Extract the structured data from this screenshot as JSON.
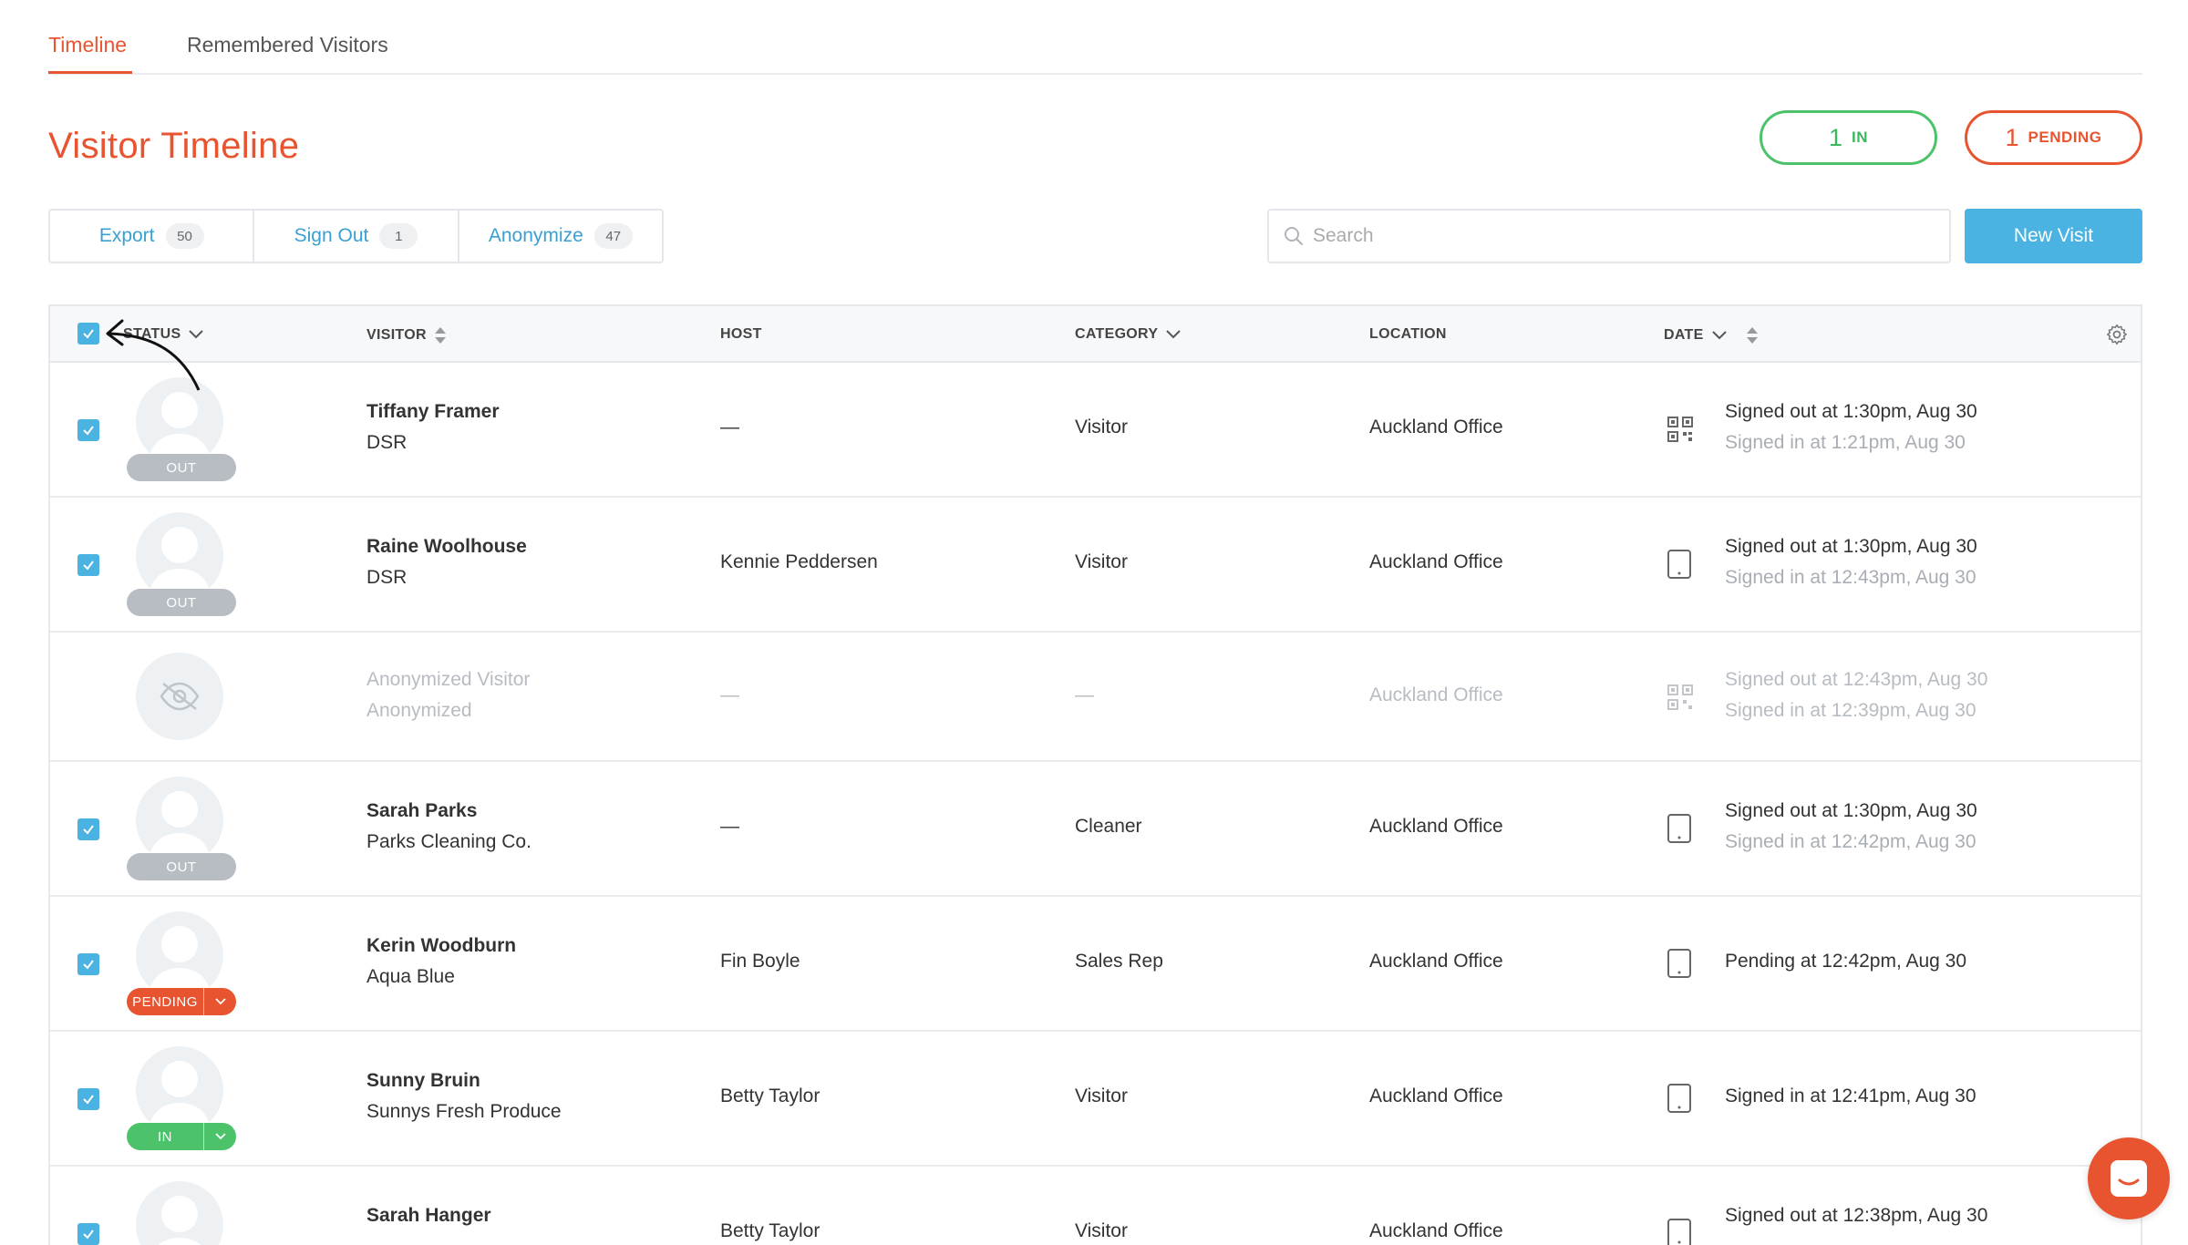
{
  "tabs": [
    {
      "label": "Timeline",
      "active": true
    },
    {
      "label": "Remembered Visitors",
      "active": false
    }
  ],
  "page_title": "Visitor Timeline",
  "summary": {
    "in": {
      "count": "1",
      "label": "IN"
    },
    "pending": {
      "count": "1",
      "label": "PENDING"
    }
  },
  "actions": {
    "export": {
      "label": "Export",
      "count": "50"
    },
    "sign_out": {
      "label": "Sign Out",
      "count": "1"
    },
    "anonymize": {
      "label": "Anonymize",
      "count": "47"
    }
  },
  "search": {
    "placeholder": "Search"
  },
  "new_visit_label": "New Visit",
  "columns": {
    "status": "STATUS",
    "visitor": "VISITOR",
    "host": "HOST",
    "category": "CATEGORY",
    "location": "LOCATION",
    "date": "DATE"
  },
  "rows": [
    {
      "checked": true,
      "badge": "OUT",
      "name": "Tiffany Framer",
      "company": "DSR",
      "host": "—",
      "category": "Visitor",
      "location": "Auckland Office",
      "device": "qr-code",
      "date_main": "Signed out at 1:30pm, Aug 30",
      "date_sub": "Signed in at 1:21pm, Aug 30"
    },
    {
      "checked": true,
      "badge": "OUT",
      "name": "Raine Woolhouse",
      "company": "DSR",
      "host": "Kennie Peddersen",
      "category": "Visitor",
      "location": "Auckland Office",
      "device": "tablet",
      "date_main": "Signed out at 1:30pm, Aug 30",
      "date_sub": "Signed in at 12:43pm, Aug 30"
    },
    {
      "checked": false,
      "badge": "",
      "anonymized": true,
      "name": "Anonymized Visitor",
      "company": "Anonymized",
      "host": "—",
      "category": "—",
      "location": "Auckland Office",
      "device": "qr-code",
      "date_main": "Signed out at 12:43pm, Aug 30",
      "date_sub": "Signed in at 12:39pm, Aug 30"
    },
    {
      "checked": true,
      "badge": "OUT",
      "name": "Sarah Parks",
      "company": "Parks Cleaning Co.",
      "host": "—",
      "category": "Cleaner",
      "location": "Auckland Office",
      "device": "tablet",
      "date_main": "Signed out at 1:30pm, Aug 30",
      "date_sub": "Signed in at 12:42pm, Aug 30"
    },
    {
      "checked": true,
      "badge": "PENDING",
      "name": "Kerin Woodburn",
      "company": "Aqua Blue",
      "host": "Fin Boyle",
      "category": "Sales Rep",
      "location": "Auckland Office",
      "device": "tablet",
      "date_main": "Pending at 12:42pm, Aug 30",
      "date_sub": ""
    },
    {
      "checked": true,
      "badge": "IN",
      "name": "Sunny Bruin",
      "company": "Sunnys Fresh Produce",
      "host": "Betty Taylor",
      "category": "Visitor",
      "location": "Auckland Office",
      "device": "tablet",
      "date_main": "Signed in at 12:41pm, Aug 30",
      "date_sub": ""
    },
    {
      "checked": true,
      "badge": "",
      "name": "Sarah Hanger",
      "company": "",
      "host": "Betty Taylor",
      "category": "Visitor",
      "location": "Auckland Office",
      "device": "tablet",
      "date_main": "Signed out at 12:38pm, Aug 30",
      "date_sub": ""
    }
  ],
  "icons": {
    "settings": "gear-icon",
    "search": "search-icon",
    "chat": "chat-icon"
  },
  "colors": {
    "brand": "#e8542f",
    "accent": "#4ab3e2",
    "in": "#4cc36a",
    "out": "#b8bdc3"
  }
}
